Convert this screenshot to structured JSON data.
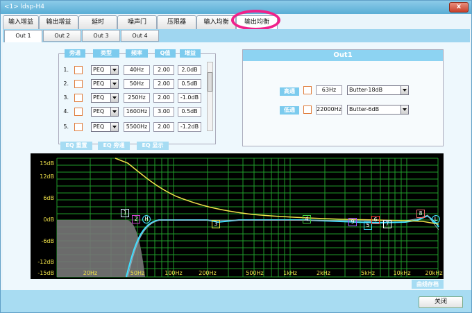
{
  "window": {
    "title": "<1> ldsp-H4",
    "close_glyph": "x"
  },
  "main_tabs": [
    {
      "label": "输入增益"
    },
    {
      "label": "输出增益"
    },
    {
      "label": "延时"
    },
    {
      "label": "噪声门"
    },
    {
      "label": "压限器"
    },
    {
      "label": "输入均衡"
    },
    {
      "label": "输出均衡"
    }
  ],
  "sub_tabs": [
    {
      "label": "Out 1"
    },
    {
      "label": "Out 2"
    },
    {
      "label": "Out 3"
    },
    {
      "label": "Out 4"
    }
  ],
  "eq_table": {
    "headers": [
      "旁通",
      "类型",
      "频率",
      "Q值",
      "增益"
    ],
    "rows": [
      {
        "num": "1.",
        "type": "PEQ",
        "freq": "40Hz",
        "q": "2.00",
        "gain": "2.0dB"
      },
      {
        "num": "2.",
        "type": "PEQ",
        "freq": "50Hz",
        "q": "2.00",
        "gain": "0.5dB"
      },
      {
        "num": "3.",
        "type": "PEQ",
        "freq": "250Hz",
        "q": "2.00",
        "gain": "-1.0dB"
      },
      {
        "num": "4.",
        "type": "PEQ",
        "freq": "1600Hz",
        "q": "3.00",
        "gain": "0.5dB"
      },
      {
        "num": "5.",
        "type": "PEQ",
        "freq": "5500Hz",
        "q": "2.00",
        "gain": "-1.2dB"
      }
    ],
    "buttons": [
      "EQ 重置",
      "EQ 旁通",
      "EQ 显示"
    ]
  },
  "out1": {
    "title": "Out1",
    "highpass": {
      "label": "高通",
      "freq": "63Hz",
      "type": "Butter-18dB"
    },
    "lowpass": {
      "label": "低通",
      "freq": "22000Hz",
      "type": "Butter-6dB"
    }
  },
  "graph": {
    "y_labels": [
      "15dB",
      "12dB",
      "6dB",
      "0dB",
      "-6dB",
      "-12dB",
      "-15dB"
    ],
    "x_labels": [
      "20Hz",
      "50Hz",
      "100Hz",
      "200Hz",
      "500Hz",
      "1kHz",
      "2kHz",
      "5kHz",
      "10kHz",
      "20kHz"
    ],
    "markers": [
      "1",
      "2",
      "H",
      "3",
      "4",
      "9",
      "5",
      "6",
      "7",
      "8",
      "L"
    ],
    "colors": {
      "grid": "#1f9d2a",
      "response": "#3fe0ff",
      "yellow": "#f0e24a"
    }
  },
  "curve_save_label": "曲线存档",
  "close_label": "关闭"
}
